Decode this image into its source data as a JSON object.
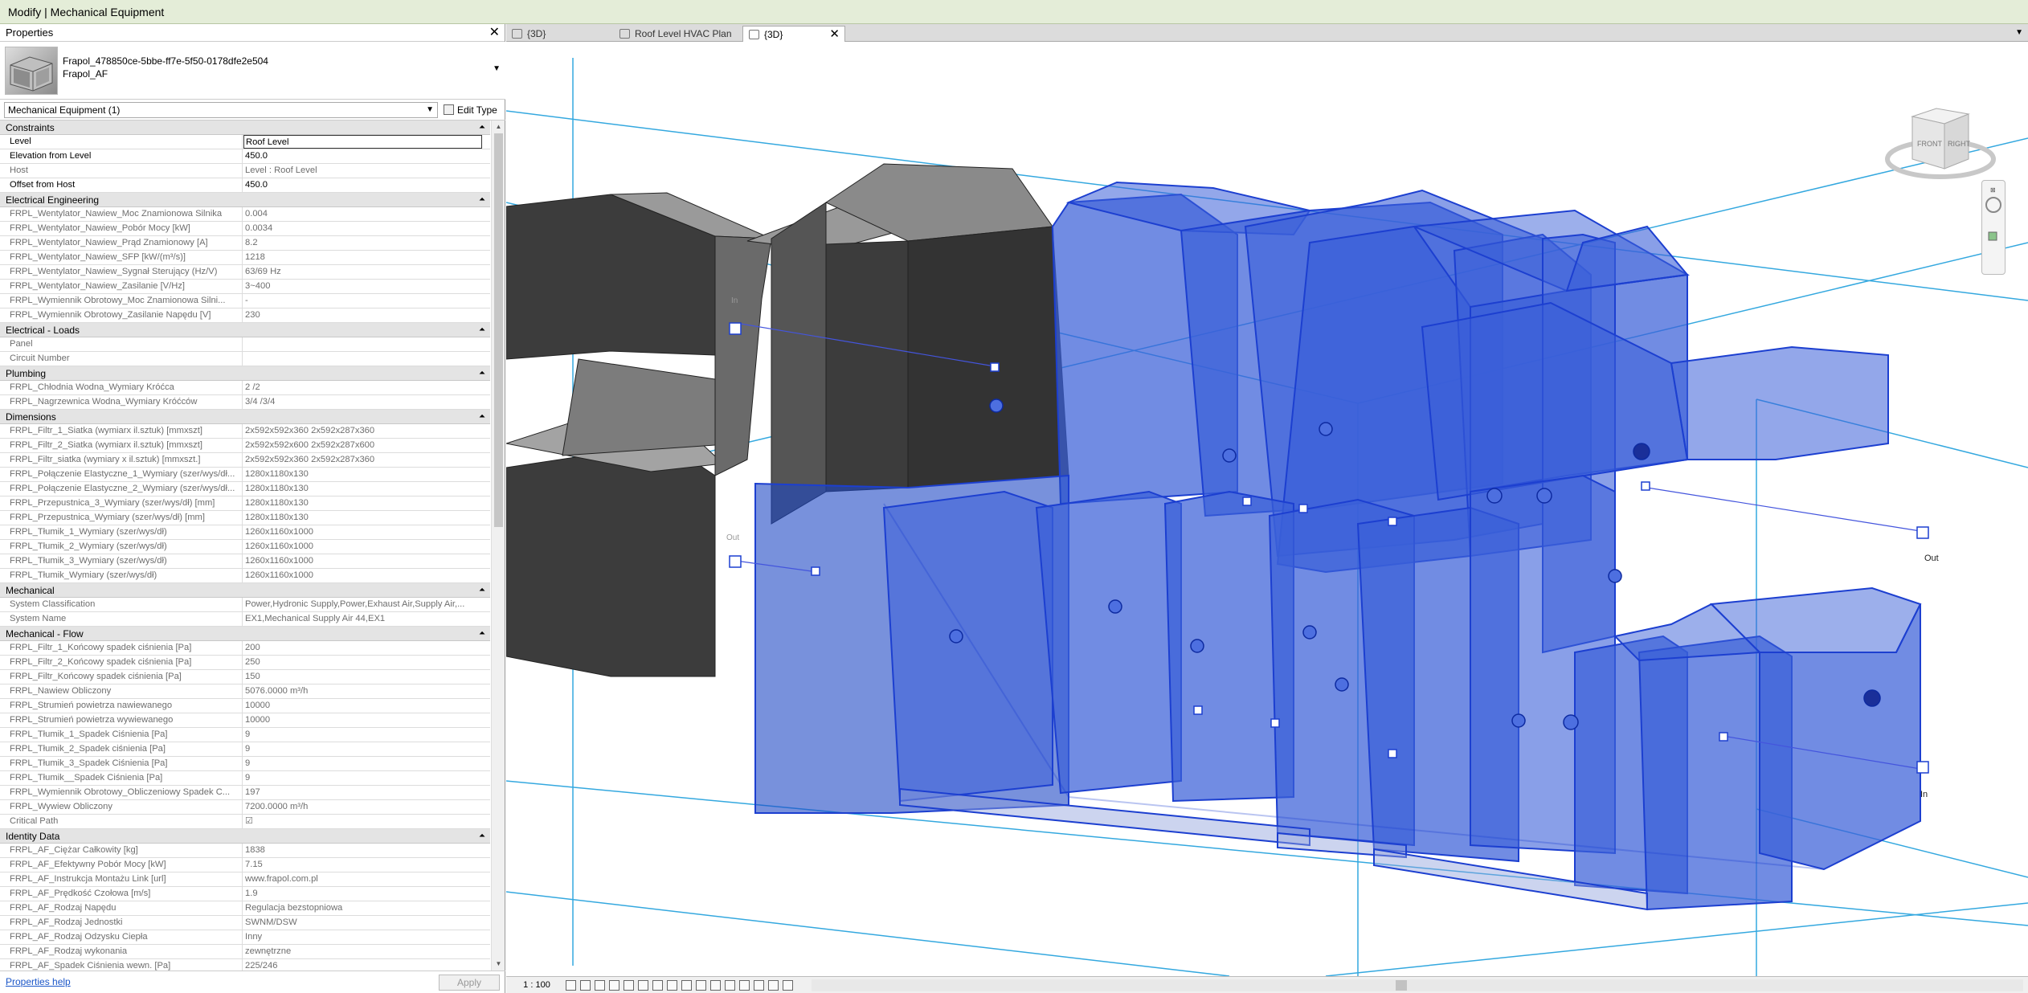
{
  "title": "Modify | Mechanical Equipment",
  "properties": {
    "header": "Properties",
    "type_name_line1": "Frapol_478850ce-5bbe-ff7e-5f50-0178dfe2e504",
    "type_name_line2": "Frapol_AF",
    "filter": "Mechanical Equipment (1)",
    "edit_type": "Edit Type",
    "help": "Properties help",
    "apply": "Apply",
    "sections": [
      {
        "title": "Constraints",
        "rows": [
          {
            "name": "Level",
            "value": "Roof Level",
            "selected": true
          },
          {
            "name": "Elevation from Level",
            "value": "450.0"
          },
          {
            "name": "Host",
            "value": "Level : Roof Level",
            "ro": true
          },
          {
            "name": "Offset from Host",
            "value": "450.0"
          }
        ]
      },
      {
        "title": "Electrical Engineering",
        "rows": [
          {
            "name": "FRPL_Wentylator_Nawiew_Moc Znamionowa Silnika",
            "value": "0.004",
            "ro": true
          },
          {
            "name": "FRPL_Wentylator_Nawiew_Pobór Mocy [kW]",
            "value": "0.0034",
            "ro": true
          },
          {
            "name": "FRPL_Wentylator_Nawiew_Prąd Znamionowy [A]",
            "value": "8.2",
            "ro": true
          },
          {
            "name": "FRPL_Wentylator_Nawiew_SFP [kW/(m³/s)]",
            "value": "1218",
            "ro": true
          },
          {
            "name": "FRPL_Wentylator_Nawiew_Sygnał Sterujący (Hz/V)",
            "value": "63/69 Hz",
            "ro": true
          },
          {
            "name": "FRPL_Wentylator_Nawiew_Zasilanie [V/Hz]",
            "value": "3~400",
            "ro": true
          },
          {
            "name": "FRPL_Wymiennik Obrotowy_Moc Znamionowa Silni...",
            "value": "-",
            "ro": true
          },
          {
            "name": "FRPL_Wymiennik Obrotowy_Zasilanie Napędu [V]",
            "value": "230",
            "ro": true
          }
        ]
      },
      {
        "title": "Electrical - Loads",
        "rows": [
          {
            "name": "Panel",
            "value": "",
            "ro": true
          },
          {
            "name": "Circuit Number",
            "value": "",
            "ro": true
          }
        ]
      },
      {
        "title": "Plumbing",
        "rows": [
          {
            "name": "FRPL_Chłodnia Wodna_Wymiary Króćca",
            "value": "2 /2",
            "ro": true
          },
          {
            "name": "FRPL_Nagrzewnica Wodna_Wymiary Króćców",
            "value": "3/4 /3/4",
            "ro": true
          }
        ]
      },
      {
        "title": "Dimensions",
        "rows": [
          {
            "name": "FRPL_Filtr_1_Siatka (wymiarx il.sztuk) [mmxszt]",
            "value": "2x592x592x360 2x592x287x360",
            "ro": true
          },
          {
            "name": "FRPL_Filtr_2_Siatka (wymiarx il.sztuk) [mmxszt]",
            "value": "2x592x592x600 2x592x287x600",
            "ro": true
          },
          {
            "name": "FRPL_Filtr_siatka (wymiary x il.sztuk) [mmxszt.]",
            "value": "2x592x592x360 2x592x287x360",
            "ro": true
          },
          {
            "name": "FRPL_Połączenie Elastyczne_1_Wymiary (szer/wys/dł...",
            "value": "1280x1180x130",
            "ro": true
          },
          {
            "name": "FRPL_Połączenie Elastyczne_2_Wymiary (szer/wys/dł...",
            "value": "1280x1180x130",
            "ro": true
          },
          {
            "name": "FRPL_Przepustnica_3_Wymiary (szer/wys/dł) [mm]",
            "value": "1280x1180x130",
            "ro": true
          },
          {
            "name": "FRPL_Przepustnica_Wymiary (szer/wys/dł) [mm]",
            "value": "1280x1180x130",
            "ro": true
          },
          {
            "name": "FRPL_Tłumik_1_Wymiary (szer/wys/dł)",
            "value": "1260x1160x1000",
            "ro": true
          },
          {
            "name": "FRPL_Tłumik_2_Wymiary (szer/wys/dł)",
            "value": "1260x1160x1000",
            "ro": true
          },
          {
            "name": "FRPL_Tłumik_3_Wymiary (szer/wys/dł)",
            "value": "1260x1160x1000",
            "ro": true
          },
          {
            "name": "FRPL_Tłumik_Wymiary (szer/wys/dł)",
            "value": "1260x1160x1000",
            "ro": true
          }
        ]
      },
      {
        "title": "Mechanical",
        "rows": [
          {
            "name": "System Classification",
            "value": "Power,Hydronic Supply,Power,Exhaust Air,Supply Air,...",
            "ro": true
          },
          {
            "name": "System Name",
            "value": "EX1,Mechanical Supply Air 44,EX1",
            "ro": true
          }
        ]
      },
      {
        "title": "Mechanical - Flow",
        "rows": [
          {
            "name": "FRPL_Filtr_1_Końcowy spadek ciśnienia [Pa]",
            "value": "200",
            "ro": true
          },
          {
            "name": "FRPL_Filtr_2_Końcowy spadek ciśnienia [Pa]",
            "value": "250",
            "ro": true
          },
          {
            "name": "FRPL_Filtr_Końcowy spadek ciśnienia [Pa]",
            "value": "150",
            "ro": true
          },
          {
            "name": "FRPL_Nawiew Obliczony",
            "value": "5076.0000 m³/h",
            "ro": true
          },
          {
            "name": "FRPL_Strumień powietrza nawiewanego",
            "value": "10000",
            "ro": true
          },
          {
            "name": "FRPL_Strumień powietrza wywiewanego",
            "value": "10000",
            "ro": true
          },
          {
            "name": "FRPL_Tłumik_1_Spadek Ciśnienia [Pa]",
            "value": "9",
            "ro": true
          },
          {
            "name": "FRPL_Tłumik_2_Spadek ciśnienia [Pa]",
            "value": "9",
            "ro": true
          },
          {
            "name": "FRPL_Tłumik_3_Spadek Ciśnienia [Pa]",
            "value": "9",
            "ro": true
          },
          {
            "name": "FRPL_Tłumik__Spadek Ciśnienia [Pa]",
            "value": "9",
            "ro": true
          },
          {
            "name": "FRPL_Wymiennik Obrotowy_Obliczeniowy Spadek C...",
            "value": "197",
            "ro": true
          },
          {
            "name": "FRPL_Wywiew Obliczony",
            "value": "7200.0000 m³/h",
            "ro": true
          },
          {
            "name": "Critical Path",
            "value": "☑",
            "ro": true
          }
        ]
      },
      {
        "title": "Identity Data",
        "rows": [
          {
            "name": "FRPL_AF_Ciężar Całkowity [kg]",
            "value": "1838",
            "ro": true
          },
          {
            "name": "FRPL_AF_Efektywny Pobór Mocy [kW]",
            "value": "7.15",
            "ro": true
          },
          {
            "name": "FRPL_AF_Instrukcja Montażu Link [url]",
            "value": "www.frapol.com.pl",
            "ro": true
          },
          {
            "name": "FRPL_AF_Prędkość Czołowa [m/s]",
            "value": "1.9",
            "ro": true
          },
          {
            "name": "FRPL_AF_Rodzaj Napędu",
            "value": "Regulacja bezstopniowa",
            "ro": true
          },
          {
            "name": "FRPL_AF_Rodzaj Jednostki",
            "value": "SWNM/DSW",
            "ro": true
          },
          {
            "name": "FRPL_AF_Rodzaj Odzysku Ciepła",
            "value": "Inny",
            "ro": true
          },
          {
            "name": "FRPL_AF_Rodzaj wykonania",
            "value": "zewnętrzne",
            "ro": true
          },
          {
            "name": "FRPL_AF_Spadek Ciśnienia wewn. [Pa]",
            "value": "225/246",
            "ro": true
          }
        ]
      }
    ]
  },
  "tabs": [
    {
      "label": "{3D}",
      "active": false
    },
    {
      "label": "Roof Level HVAC Plan",
      "active": false
    },
    {
      "label": "{3D}",
      "active": true
    }
  ],
  "viewport": {
    "labels": {
      "out_right": "Out",
      "in_right": "In",
      "out_left": "Out",
      "in_left": "In"
    },
    "viewcube": {
      "front": "FRONT",
      "right": "RIGHT"
    },
    "scale": "1 : 100"
  },
  "colors": {
    "equipment_blue": "#3a5fd8",
    "duct_dark": "#3c3c3c",
    "title_bg": "#e4edd8",
    "guide_line": "#34a8df"
  }
}
